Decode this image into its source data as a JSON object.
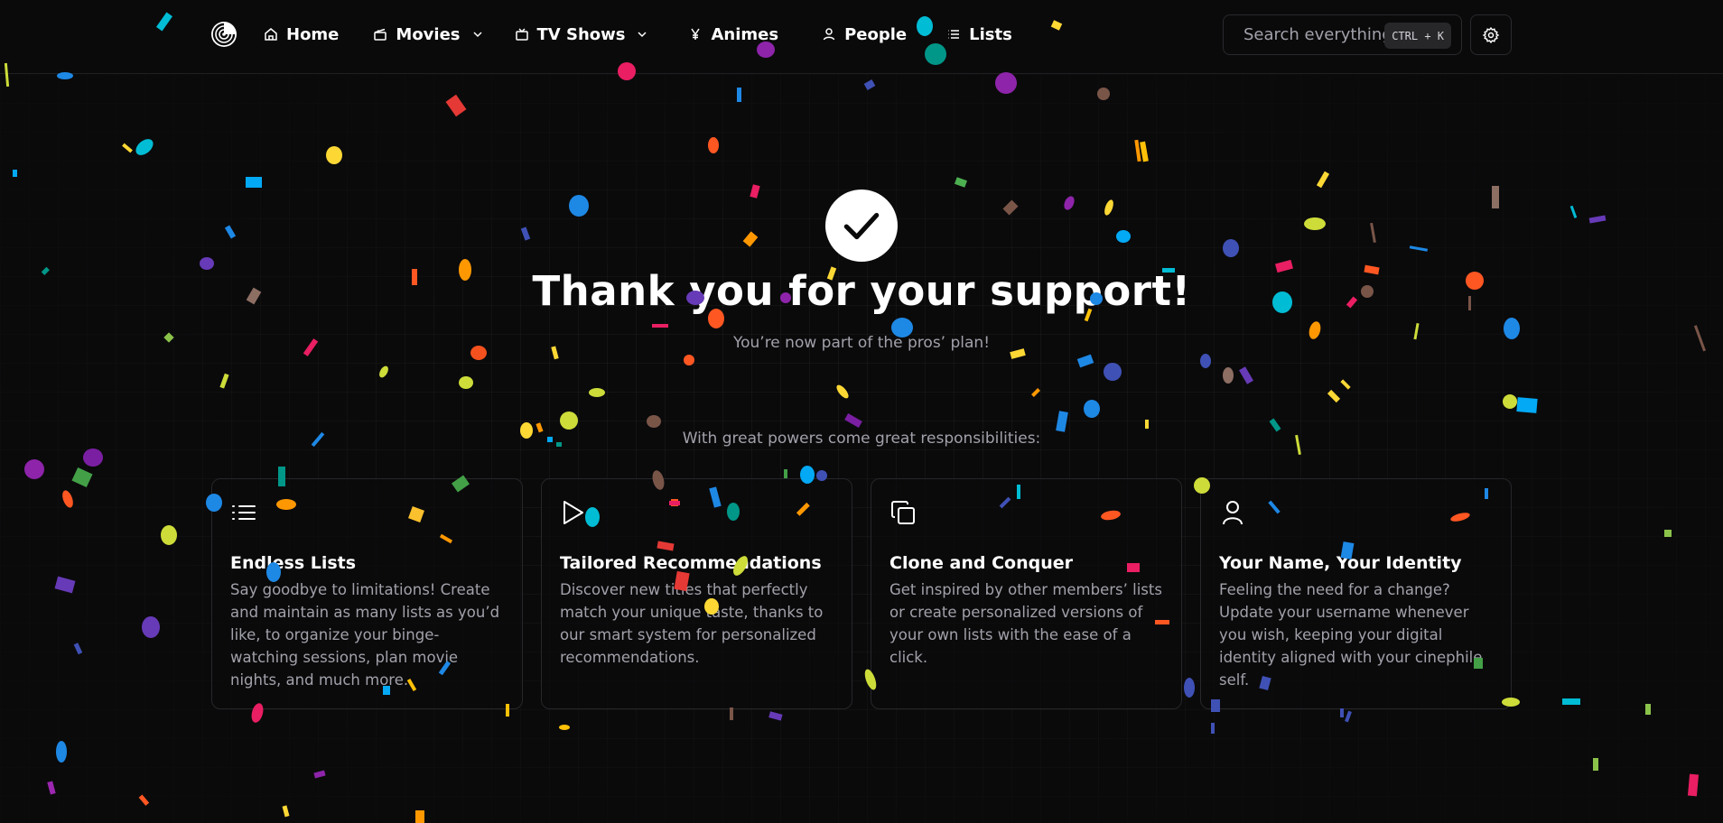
{
  "nav": {
    "home": "Home",
    "movies": "Movies",
    "tv_shows": "TV Shows",
    "animes": "Animes",
    "people": "People",
    "lists": "Lists"
  },
  "search": {
    "placeholder": "Search everything",
    "shortcut": "CTRL + K"
  },
  "hero": {
    "title": "Thank you for your support!",
    "subtitle": "You’re now part of the pros’ plan!"
  },
  "features": {
    "label": "With great powers come great responsibilities:",
    "items": [
      {
        "icon": "list-icon",
        "title": "Endless Lists",
        "description": "Say goodbye to limitations! Create and maintain as many lists as you’d like, to organize your binge-watching sessions, plan movie nights, and much more."
      },
      {
        "icon": "play-icon",
        "title": "Tailored Recommendations",
        "description": "Discover new titles that perfectly match your unique taste, thanks to our smart system for personalized recommendations."
      },
      {
        "icon": "copy-icon",
        "title": "Clone and Conquer",
        "description": "Get inspired by other members’ lists or create personalized versions of your own lists with the ease of a click."
      },
      {
        "icon": "user-icon",
        "title": "Your Name, Your Identity",
        "description": "Feeling the need for a change? Update your username whenever you wish, keeping your digital identity aligned with your cinephile self."
      }
    ]
  },
  "colors": {
    "background": "#0a0a0b",
    "muted_text": "#a1a1aa",
    "border": "#27272a",
    "confetti": [
      "#1e88e5",
      "#e91e63",
      "#8e24aa",
      "#43a047",
      "#fdd835",
      "#ff5722",
      "#00bcd4",
      "#673ab7",
      "#795548",
      "#cddc39",
      "#ff9800",
      "#3f51b5"
    ]
  }
}
